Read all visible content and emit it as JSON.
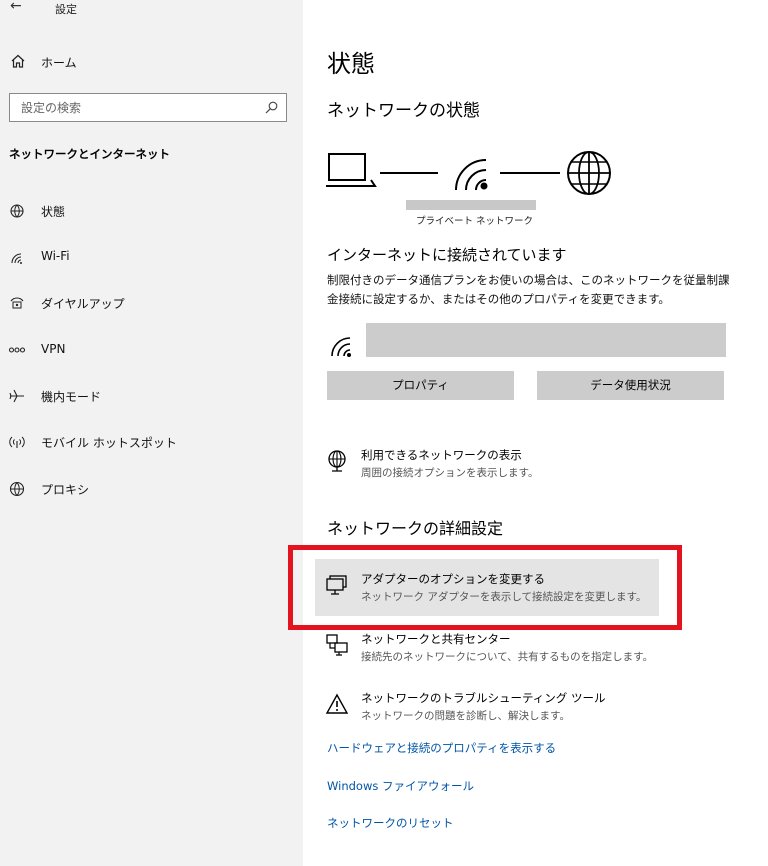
{
  "window": {
    "title": "設定"
  },
  "sidebar": {
    "home_label": "ホーム",
    "search_placeholder": "設定の検索",
    "section_heading": "ネットワークとインターネット",
    "items": [
      {
        "label": "状態",
        "icon": "globe-status-icon"
      },
      {
        "label": "Wi-Fi",
        "icon": "wifi-icon"
      },
      {
        "label": "ダイヤルアップ",
        "icon": "dialup-icon"
      },
      {
        "label": "VPN",
        "icon": "vpn-icon"
      },
      {
        "label": "機内モード",
        "icon": "airplane-icon"
      },
      {
        "label": "モバイル ホットスポット",
        "icon": "hotspot-icon"
      },
      {
        "label": "プロキシ",
        "icon": "proxy-globe-icon"
      }
    ]
  },
  "main": {
    "title": "状態",
    "network_status_heading": "ネットワークの状態",
    "network_name_label": "プライベート ネットワーク",
    "connection_title": "インターネットに接続されています",
    "connection_desc": "制限付きのデータ通信プランをお使いの場合は、このネットワークを従量制課金接続に設定するか、またはその他のプロパティを変更できます。",
    "properties_button": "プロパティ",
    "data_usage_button": "データ使用状況",
    "show_networks": {
      "title": "利用できるネットワークの表示",
      "desc": "周囲の接続オプションを表示します。"
    },
    "advanced_heading": "ネットワークの詳細設定",
    "adapter_options": {
      "title": "アダプターのオプションを変更する",
      "desc": "ネットワーク アダプターを表示して接続設定を変更します。"
    },
    "sharing_center": {
      "title": "ネットワークと共有センター",
      "desc": "接続先のネットワークについて、共有するものを指定します。"
    },
    "troubleshooter": {
      "title": "ネットワークのトラブルシューティング ツール",
      "desc": "ネットワークの問題を診断し、解決します。"
    },
    "links": {
      "hardware_properties": "ハードウェアと接続のプロパティを表示する",
      "firewall": "Windows ファイアウォール",
      "reset": "ネットワークのリセット"
    }
  },
  "colors": {
    "sidebar_bg": "#f2f2f2",
    "link": "#0055a7",
    "highlight_frame": "#e3141f",
    "button_bg": "#cccccc"
  }
}
